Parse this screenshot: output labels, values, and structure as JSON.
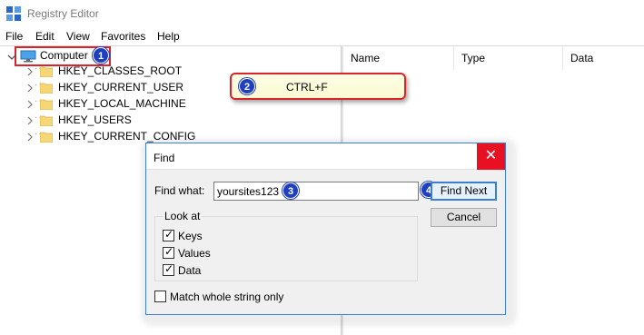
{
  "window": {
    "title": "Registry Editor"
  },
  "menu": [
    "File",
    "Edit",
    "View",
    "Favorites",
    "Help"
  ],
  "tree": {
    "root": "Computer",
    "keys": [
      "HKEY_CLASSES_ROOT",
      "HKEY_CURRENT_USER",
      "HKEY_LOCAL_MACHINE",
      "HKEY_USERS",
      "HKEY_CURRENT_CONFIG"
    ]
  },
  "list_columns": [
    "Name",
    "Type",
    "Data"
  ],
  "callout": {
    "text": "CTRL+F"
  },
  "badges": [
    "1",
    "2",
    "3",
    "4"
  ],
  "find_dialog": {
    "title": "Find",
    "close": "✕",
    "find_what_label": "Find what:",
    "find_what_value": "yoursites123",
    "find_next": "Find Next",
    "cancel": "Cancel",
    "look_at_label": "Look at",
    "options": [
      {
        "label": "Keys",
        "checked": true
      },
      {
        "label": "Values",
        "checked": true
      },
      {
        "label": "Data",
        "checked": true
      }
    ],
    "match_whole": {
      "label": "Match whole string only",
      "checked": false
    }
  },
  "colors": {
    "highlight": "#d9242c",
    "badge": "#1f3fbf",
    "close": "#e81123",
    "callout_fill": "#fafad2"
  }
}
